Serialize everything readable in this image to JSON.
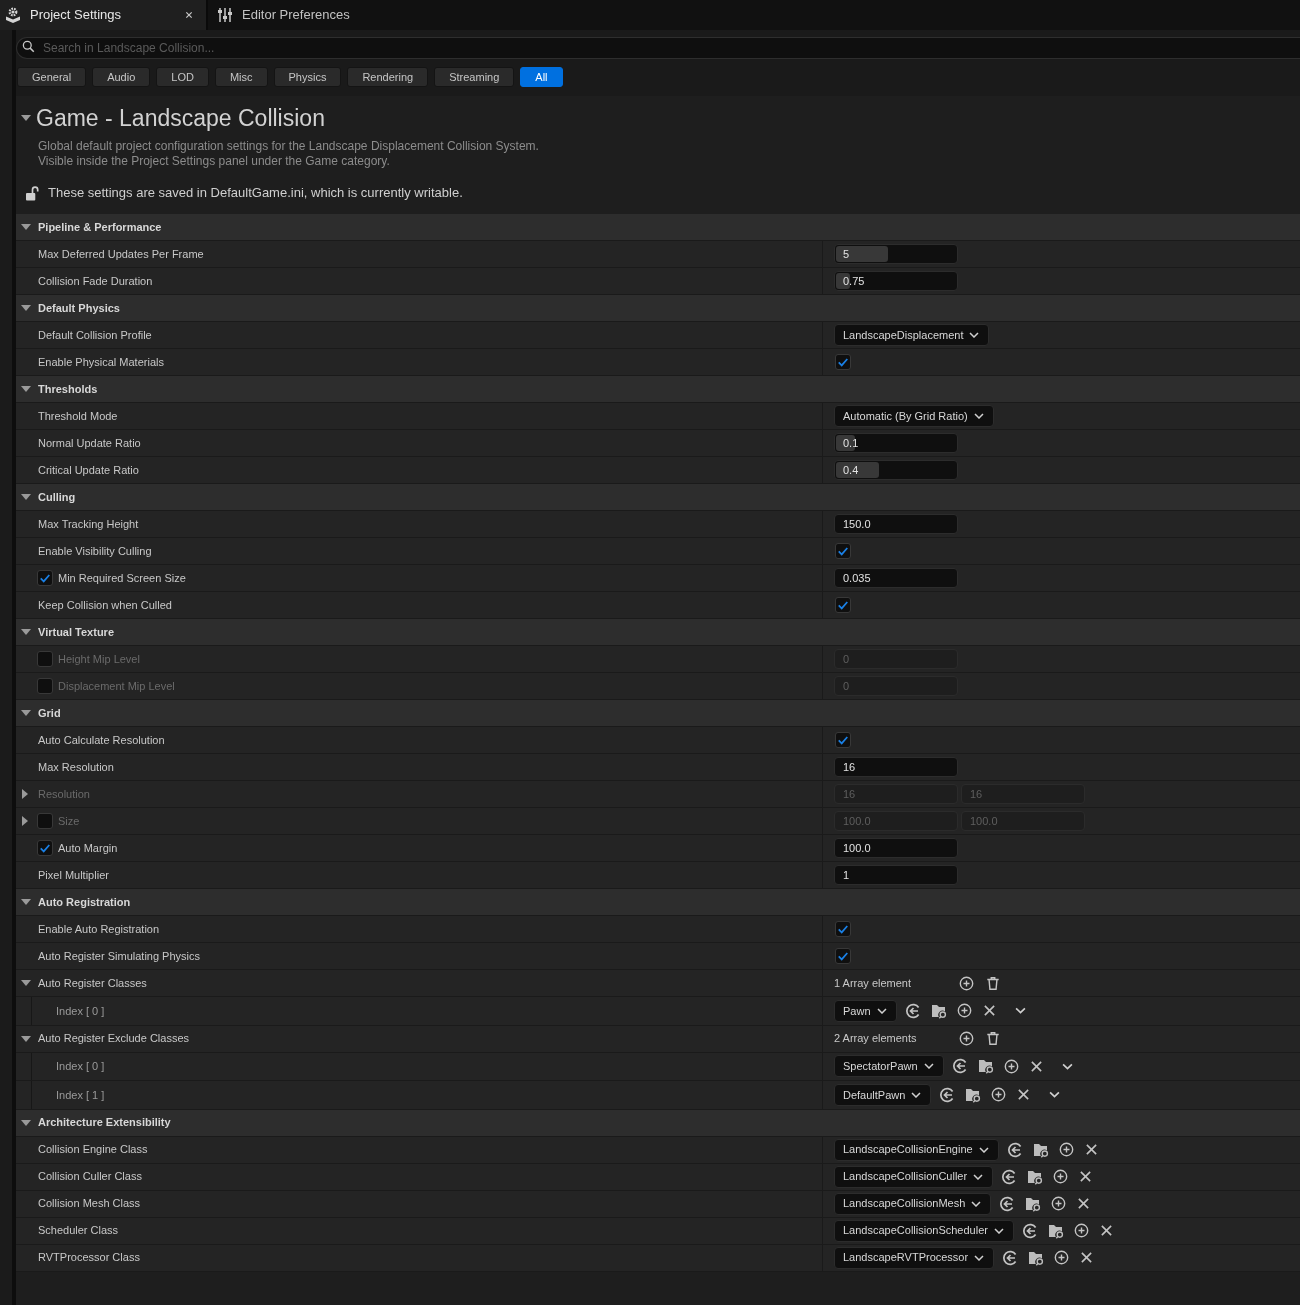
{
  "tabs": [
    {
      "label": "Project Settings",
      "selected": true
    },
    {
      "label": "Editor Preferences",
      "selected": false
    }
  ],
  "search": {
    "placeholder": "Search in Landscape Collision..."
  },
  "filters": [
    {
      "label": "General",
      "selected": false
    },
    {
      "label": "Audio",
      "selected": false
    },
    {
      "label": "LOD",
      "selected": false
    },
    {
      "label": "Misc",
      "selected": false
    },
    {
      "label": "Physics",
      "selected": false
    },
    {
      "label": "Rendering",
      "selected": false
    },
    {
      "label": "Streaming",
      "selected": false
    },
    {
      "label": "All",
      "selected": true
    }
  ],
  "section": {
    "title": "Game - Landscape Collision",
    "expanded": true,
    "description": [
      "Global default project configuration settings for the Landscape Displacement Collision System.",
      "Visible inside the Project Settings panel under the Game category."
    ],
    "notice": "These settings are saved in DefaultGame.ini, which is currently writable."
  },
  "categories": [
    {
      "title": "Pipeline & Performance",
      "expanded": true,
      "properties": [
        {
          "label": "Max Deferred Updates Per Frame",
          "kind": "slider",
          "disabled": false,
          "value": "5",
          "level": 0.43
        },
        {
          "label": "Collision Fade Duration",
          "kind": "slider",
          "disabled": false,
          "value": "0.75",
          "level": 0.12
        }
      ]
    },
    {
      "title": "Default Physics",
      "expanded": true,
      "properties": [
        {
          "label": "Default Collision Profile",
          "kind": "dropdown",
          "disabled": false,
          "value": "LandscapeDisplacement"
        },
        {
          "label": "Enable Physical Materials",
          "kind": "checkbox",
          "disabled": false,
          "checked": true
        }
      ]
    },
    {
      "title": "Thresholds",
      "expanded": true,
      "properties": [
        {
          "label": "Threshold Mode",
          "kind": "dropdown",
          "disabled": false,
          "value": "Automatic (By Grid Ratio)"
        },
        {
          "label": "Normal Update Ratio",
          "kind": "slider",
          "disabled": false,
          "value": "0.1",
          "level": 0.16
        },
        {
          "label": "Critical Update Ratio",
          "kind": "slider",
          "disabled": false,
          "value": "0.4",
          "level": 0.36
        }
      ]
    },
    {
      "title": "Culling",
      "expanded": true,
      "properties": [
        {
          "label": "Max Tracking Height",
          "kind": "number",
          "disabled": false,
          "value": "150.0"
        },
        {
          "label": "Enable Visibility Culling",
          "kind": "checkbox",
          "disabled": false,
          "checked": true
        },
        {
          "label": "Min Required Screen Size",
          "kind": "number",
          "disabled": false,
          "override": true,
          "value": "0.035"
        },
        {
          "label": "Keep Collision when Culled",
          "kind": "checkbox",
          "disabled": false,
          "checked": true
        }
      ]
    },
    {
      "title": "Virtual Texture",
      "expanded": true,
      "properties": [
        {
          "label": "Height Mip Level",
          "kind": "number",
          "disabled": true,
          "override": false,
          "value": "0"
        },
        {
          "label": "Displacement Mip Level",
          "kind": "number",
          "disabled": true,
          "override": false,
          "value": "0"
        }
      ]
    },
    {
      "title": "Grid",
      "expanded": true,
      "properties": [
        {
          "label": "Auto Calculate Resolution",
          "kind": "checkbox",
          "disabled": false,
          "checked": true
        },
        {
          "label": "Max Resolution",
          "kind": "number",
          "disabled": false,
          "value": "16"
        },
        {
          "label": "Resolution",
          "kind": "pair",
          "disabled": true,
          "expanded": false,
          "values": [
            "16",
            "16"
          ]
        },
        {
          "label": "Size",
          "kind": "pair",
          "disabled": true,
          "expanded": false,
          "override": false,
          "values": [
            "100.0",
            "100.0"
          ]
        },
        {
          "label": "Auto Margin",
          "kind": "number",
          "disabled": false,
          "override": true,
          "value": "100.0"
        },
        {
          "label": "Pixel Multiplier",
          "kind": "number",
          "disabled": false,
          "value": "1"
        }
      ]
    },
    {
      "title": "Auto Registration",
      "expanded": true,
      "properties": [
        {
          "label": "Enable Auto Registration",
          "kind": "checkbox",
          "disabled": false,
          "checked": true
        },
        {
          "label": "Auto Register Simulating Physics",
          "kind": "checkbox",
          "disabled": false,
          "checked": true
        },
        {
          "label": "Auto Register Classes",
          "kind": "array",
          "disabled": false,
          "expanded": true,
          "count": "1 Array element",
          "children": [
            {
              "label": "Index [ 0 ]",
              "value": "Pawn"
            }
          ]
        },
        {
          "label": "Auto Register Exclude Classes",
          "kind": "array",
          "disabled": false,
          "expanded": true,
          "count": "2 Array elements",
          "children": [
            {
              "label": "Index [ 0 ]",
              "value": "SpectatorPawn"
            },
            {
              "label": "Index [ 1 ]",
              "value": "DefaultPawn"
            }
          ]
        }
      ]
    },
    {
      "title": "Architecture Extensibility",
      "expanded": true,
      "properties": [
        {
          "label": "Collision Engine Class",
          "kind": "class",
          "disabled": false,
          "value": "LandscapeCollisionEngine"
        },
        {
          "label": "Collision Culler Class",
          "kind": "class",
          "disabled": false,
          "value": "LandscapeCollisionCuller"
        },
        {
          "label": "Collision Mesh Class",
          "kind": "class",
          "disabled": false,
          "value": "LandscapeCollisionMesh"
        },
        {
          "label": "Scheduler Class",
          "kind": "class",
          "disabled": false,
          "value": "LandscapeCollisionScheduler"
        },
        {
          "label": "RVTProcessor Class",
          "kind": "class",
          "disabled": false,
          "value": "LandscapeRVTProcessor"
        }
      ]
    }
  ]
}
